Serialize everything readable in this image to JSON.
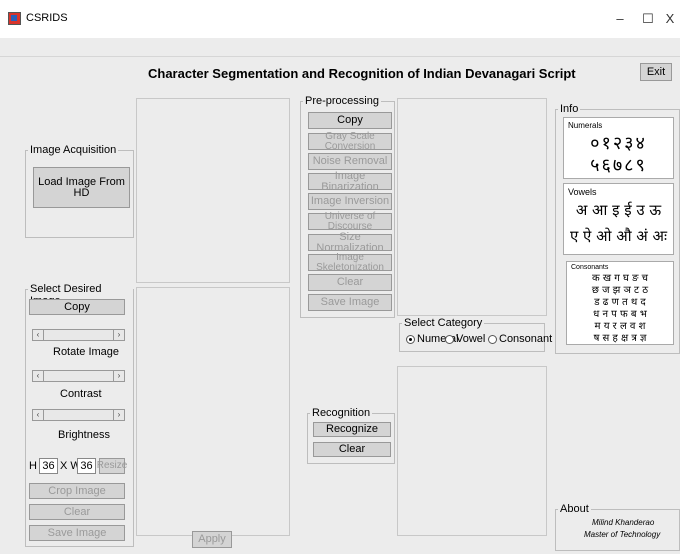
{
  "window": {
    "title": "CSRIDS",
    "minimize": "–",
    "maximize": "☐",
    "close": "X"
  },
  "header": {
    "heading": "Character Segmentation and Recognition of Indian Devanagari Script",
    "exit_label": "Exit"
  },
  "image_acquisition": {
    "legend": "Image Acquisition",
    "load_label": "Load Image From HD"
  },
  "select_image": {
    "legend": "Select Desired Image",
    "copy_label": "Copy",
    "rotate_label": "Rotate Image",
    "contrast_label": "Contrast",
    "brightness_label": "Brightness",
    "h_label": "H",
    "h_value": "36",
    "xw_label": "X W",
    "w_value": "36",
    "resize_label": "Resize",
    "crop_label": "Crop Image",
    "clear_label": "Clear",
    "save_label": "Save Image"
  },
  "apply_label": "Apply",
  "preprocessing": {
    "legend": "Pre-processing",
    "copy_label": "Copy",
    "gray_label": "Gray Scale Conversion",
    "noise_label": "Noise Removal",
    "binarization_label": "Image Binarization",
    "inversion_label": "Image Inversion",
    "universe_label": "Universe of Discourse",
    "size_label": "Size Normalization",
    "skeleton_label": "Image Skeletonization",
    "clear_label": "Clear",
    "save_label": "Save Image"
  },
  "category": {
    "legend": "Select Category",
    "options": [
      "Numeral",
      "Vowel",
      "Consonant"
    ],
    "selected": "Numeral"
  },
  "recognition": {
    "legend": "Recognition",
    "recognize_label": "Recognize",
    "clear_label": "Clear"
  },
  "info": {
    "legend": "Info",
    "numerals_title": "Numerals",
    "numerals_row1": "०१२३४",
    "numerals_row2": "५६७८९",
    "vowels_title": "Vowels",
    "vowels_row1": "अ आ इ ई उ ऊ",
    "vowels_row2": "ए ऐ ओ औ अं अः",
    "consonants_title": "Consonants",
    "consonants_rows": [
      "क ख ग घ ङ च",
      "छ ज झ ञ ट ठ",
      "ड ढ ण त थ द",
      "ध न प फ ब भ",
      "म य र ल व श",
      "ष स ह क्ष त्र ज्ञ"
    ]
  },
  "about": {
    "legend": "About",
    "name": "Milind Khanderao",
    "degree": "Master of Technology"
  }
}
